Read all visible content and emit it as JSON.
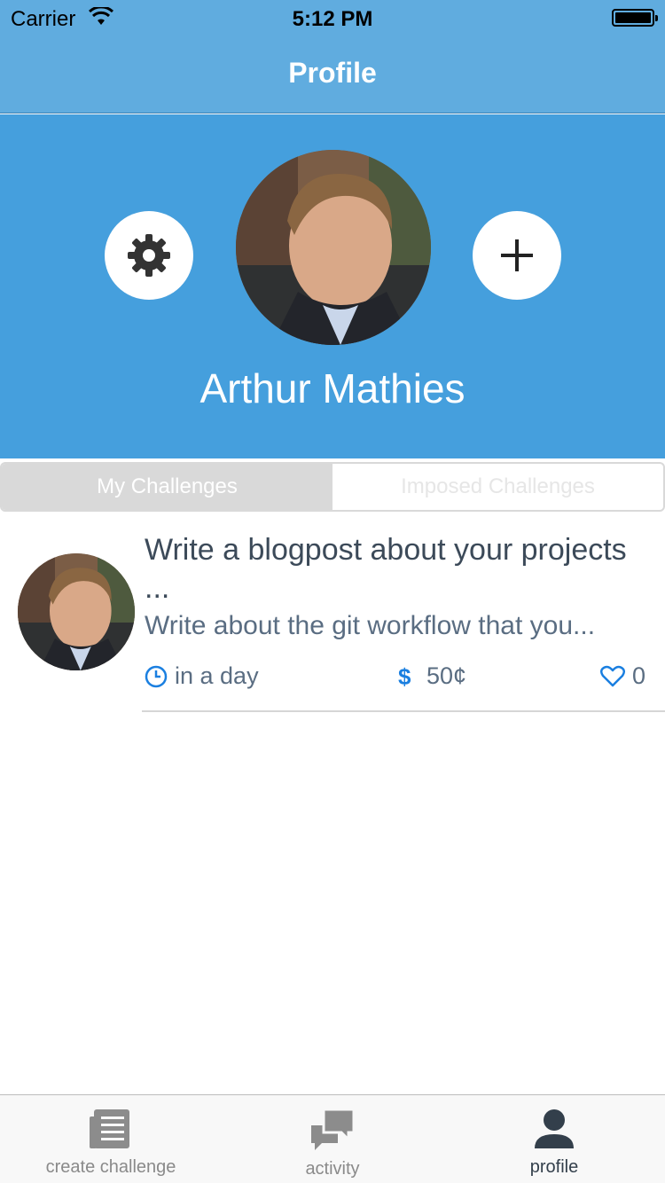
{
  "status_bar": {
    "carrier": "Carrier",
    "time": "5:12 PM"
  },
  "nav": {
    "title": "Profile"
  },
  "profile": {
    "name": "Arthur Mathies",
    "settings_icon": "gear-icon",
    "add_icon": "plus-icon"
  },
  "segments": {
    "my_challenges": "My Challenges",
    "imposed_challenges": "Imposed Challenges",
    "selected": "My Challenges"
  },
  "challenges": [
    {
      "title": "Write a blogpost about your projects ...",
      "description": "Write about the git workflow that you...",
      "deadline": "in a day",
      "price": "50¢",
      "likes": "0"
    }
  ],
  "tabs": [
    {
      "label": "create challenge",
      "icon": "document-icon"
    },
    {
      "label": "activity",
      "icon": "chat-icon"
    },
    {
      "label": "profile",
      "icon": "person-icon"
    }
  ],
  "colors": {
    "nav_blue": "#60acdf",
    "header_blue": "#459fdd",
    "accent_blue": "#1a7fe0",
    "text_dark": "#3c4a59"
  }
}
